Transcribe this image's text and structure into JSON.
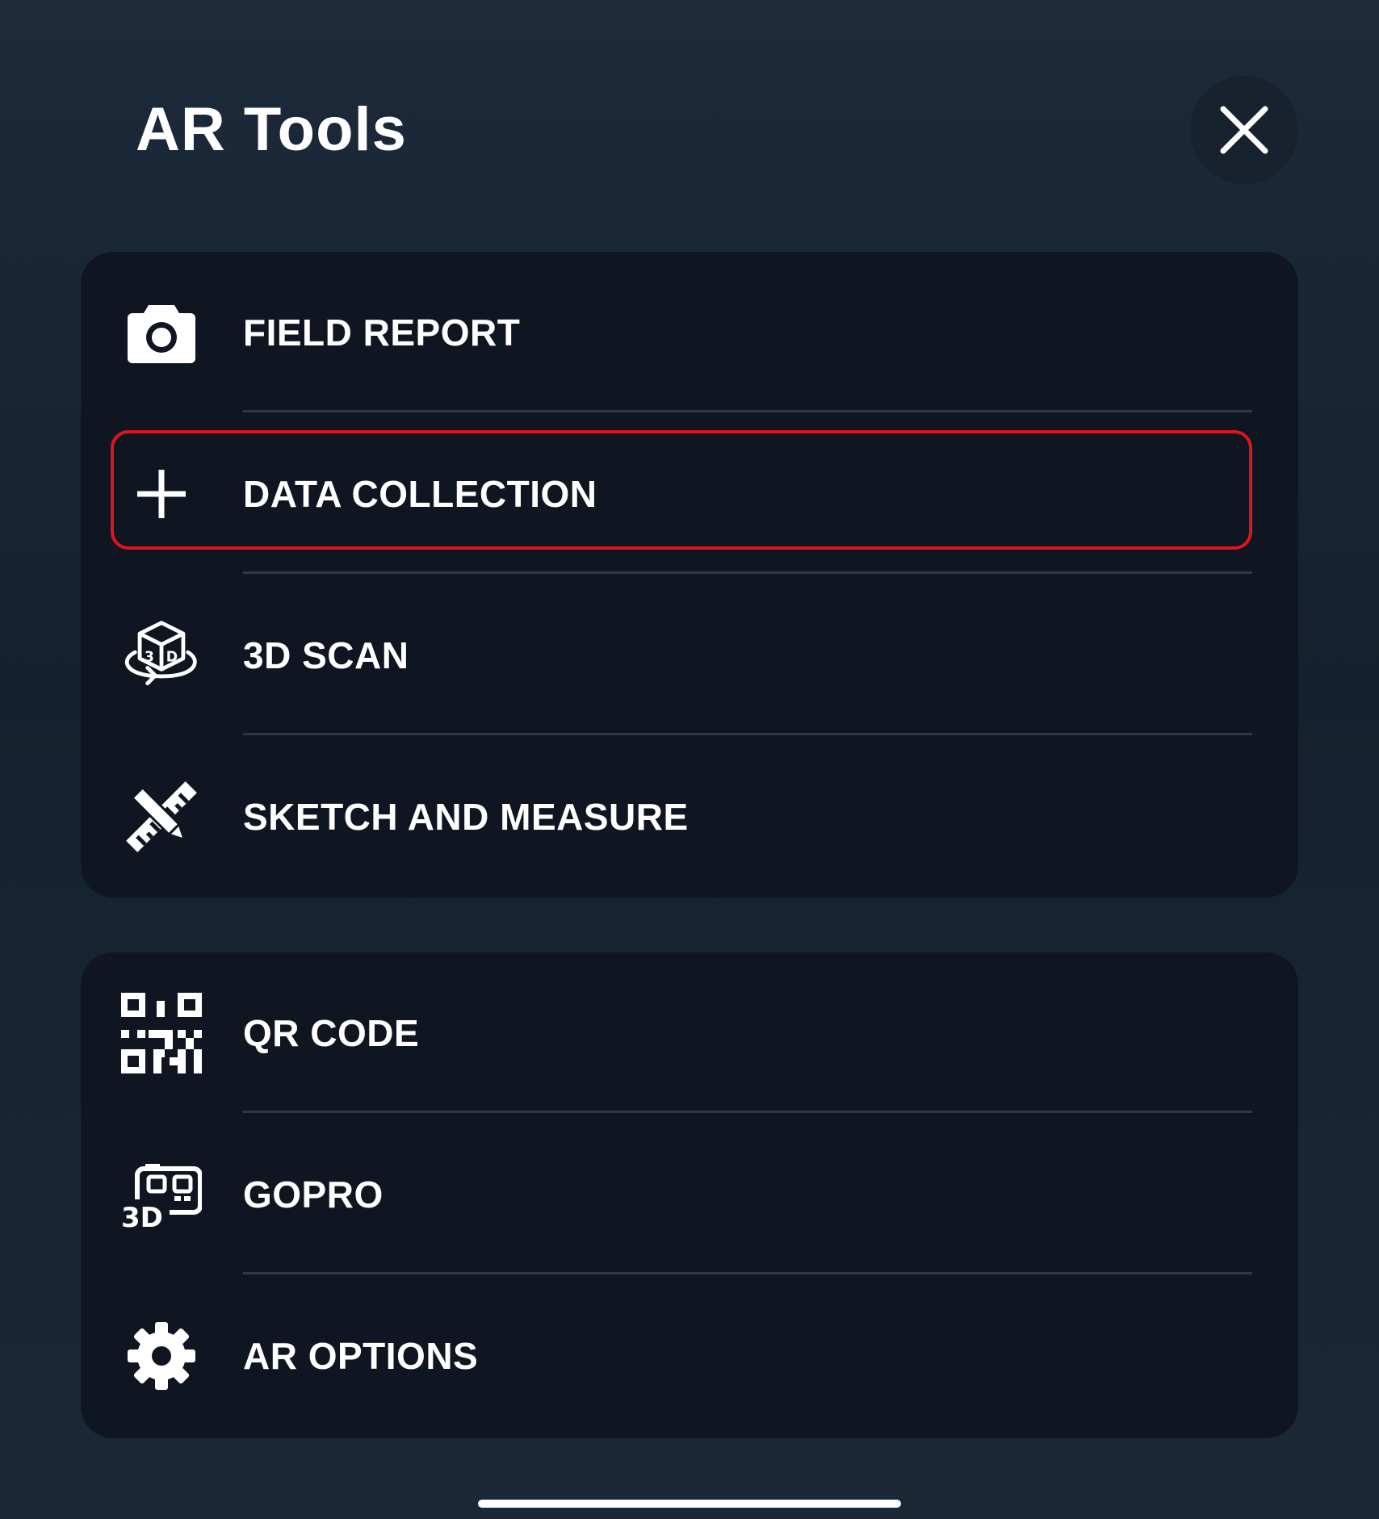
{
  "header": {
    "title": "AR Tools",
    "close_icon": "close-icon"
  },
  "highlight": {
    "item": "data_collection",
    "color": "#e0141b"
  },
  "groups": [
    {
      "items": [
        {
          "key": "field_report",
          "label": "FIELD REPORT",
          "icon": "camera-icon"
        },
        {
          "key": "data_collection",
          "label": "DATA COLLECTION",
          "icon": "plus-icon"
        },
        {
          "key": "3d_scan",
          "label": "3D SCAN",
          "icon": "3d-cube-icon"
        },
        {
          "key": "sketch_measure",
          "label": "SKETCH AND MEASURE",
          "icon": "ruler-pencil-icon"
        }
      ]
    },
    {
      "items": [
        {
          "key": "qr_code",
          "label": "QR CODE",
          "icon": "qr-code-icon"
        },
        {
          "key": "gopro",
          "label": "GOPRO",
          "icon": "gopro-3d-icon"
        },
        {
          "key": "ar_options",
          "label": "AR OPTIONS",
          "icon": "gear-icon"
        }
      ]
    }
  ],
  "colors": {
    "background": "#18242f",
    "card": "#0f1622",
    "divider": "#2e3946",
    "text": "#ffffff"
  }
}
